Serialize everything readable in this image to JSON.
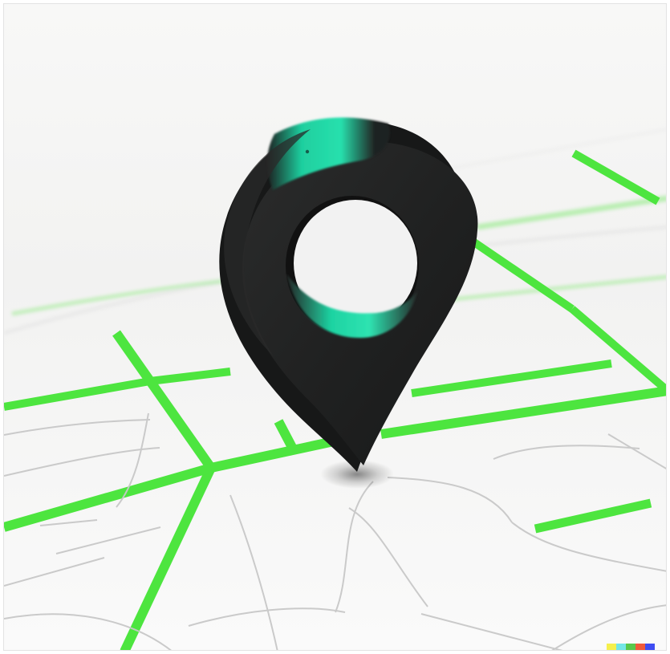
{
  "image": {
    "colors": {
      "background": "#f7f7f6",
      "road_green": "#4be83c",
      "road_green_soft": "#7ae96a",
      "thin_road": "#c7c7c7",
      "pin_dark": "#202121",
      "pin_teal": "#20d6a1",
      "shadow": "#333333"
    },
    "watermark_colors": [
      "#f5f04d",
      "#73e6e6",
      "#58c84a",
      "#f05a3a",
      "#3f4df2"
    ]
  }
}
